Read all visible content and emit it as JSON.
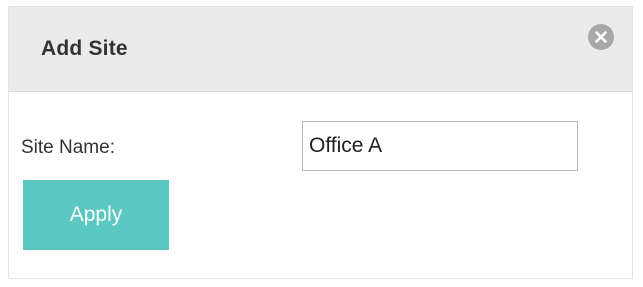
{
  "dialog": {
    "title": "Add Site",
    "close_icon": "close-icon"
  },
  "form": {
    "site_name_label": "Site Name:",
    "site_name_value": "Office A"
  },
  "actions": {
    "apply_label": "Apply"
  },
  "colors": {
    "header_bg": "#ebebeb",
    "apply_button": "#5bc9c2",
    "close_button": "#a8a8a8"
  }
}
